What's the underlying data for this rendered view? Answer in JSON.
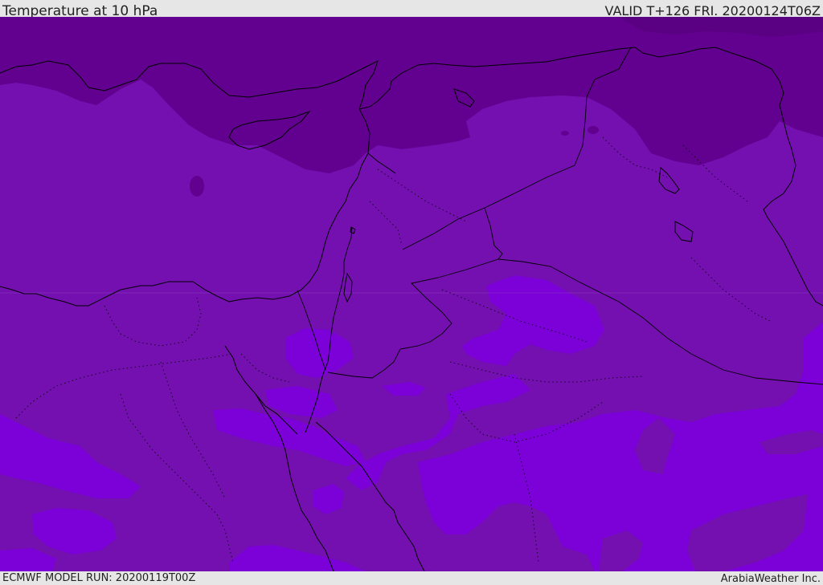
{
  "header": {
    "title": "Temperature at 10 hPa",
    "valid": "VALID T+126 FRI. 20200124T06Z"
  },
  "footer": {
    "model_run": "ECMWF MODEL RUN: 20200119T00Z",
    "credit": "ArabiaWeather Inc."
  },
  "map": {
    "fill_colors": {
      "dark": "#62008f",
      "mid": "#7410b0",
      "light": "#7c00d8"
    },
    "line_colors": {
      "coast": "#000000",
      "borders": "#000000"
    }
  }
}
